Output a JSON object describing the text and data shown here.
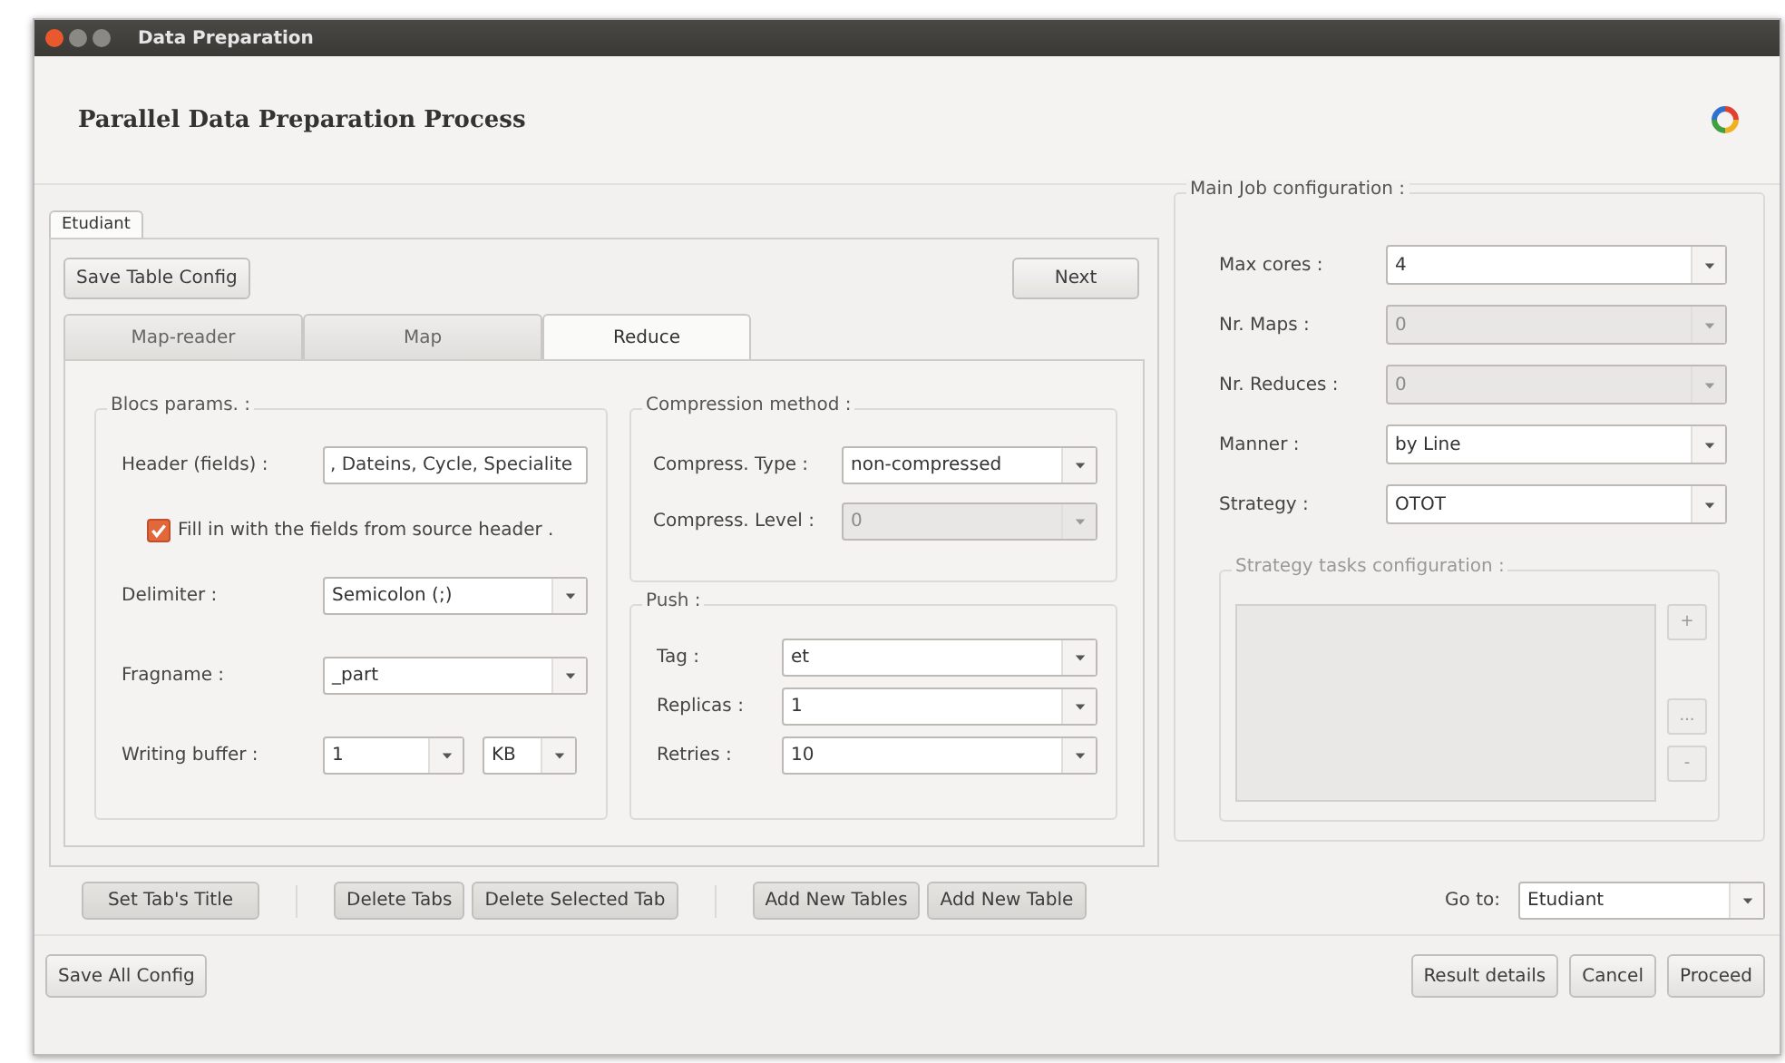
{
  "window": {
    "title": "Data Preparation"
  },
  "header": {
    "title": "Parallel Data Preparation Process"
  },
  "table_tabs": [
    {
      "label": "Etudiant",
      "selected": true
    }
  ],
  "save_table_config": "Save Table Config",
  "next": "Next",
  "step_tabs": [
    {
      "label": "Map-reader",
      "selected": false
    },
    {
      "label": "Map",
      "selected": false
    },
    {
      "label": "Reduce",
      "selected": true
    }
  ],
  "blocs_params": {
    "title": "Blocs params. :",
    "fields": [
      {
        "kind": "text",
        "label": "Header (fields) :",
        "value": ", Dateins, Cycle, Specialite"
      },
      {
        "kind": "checkbox",
        "label": "Fill in with the fields from source header .",
        "checked": true
      },
      {
        "kind": "combo",
        "label": "Delimiter :",
        "value": "Semicolon  (;)",
        "disabled": false
      },
      {
        "kind": "combo",
        "label": "Fragname :",
        "value": "_part",
        "disabled": false
      },
      {
        "kind": "combo",
        "label": "Writing buffer :",
        "value": "1",
        "unit": "KB",
        "disabled": false
      }
    ]
  },
  "compression": {
    "title": "Compression method :",
    "fields": [
      {
        "kind": "combo",
        "label": "Compress. Type :",
        "value": "non-compressed",
        "disabled": false
      },
      {
        "kind": "combo",
        "label": "Compress. Level :",
        "value": "0",
        "disabled": true
      }
    ]
  },
  "push": {
    "title": "Push :",
    "fields": [
      {
        "kind": "combo",
        "label": "Tag :",
        "value": "et",
        "disabled": false
      },
      {
        "kind": "combo",
        "label": "Replicas :",
        "value": "1",
        "disabled": false
      },
      {
        "kind": "combo",
        "label": "Retries :",
        "value": "10",
        "disabled": false
      }
    ]
  },
  "main_job": {
    "title": "Main Job configuration :",
    "fields": [
      {
        "kind": "combo",
        "label": "Max cores :",
        "value": "4",
        "disabled": false
      },
      {
        "kind": "combo",
        "label": "Nr. Maps :",
        "value": "0",
        "disabled": true
      },
      {
        "kind": "combo",
        "label": "Nr. Reduces :",
        "value": "0",
        "disabled": true
      },
      {
        "kind": "combo",
        "label": "Manner :",
        "value": "by Line",
        "disabled": false
      },
      {
        "kind": "combo",
        "label": "Strategy :",
        "value": "OTOT",
        "disabled": false
      }
    ]
  },
  "strategy_tasks": {
    "title": "Strategy tasks configuration :",
    "disabled": true,
    "buttons": [
      "+",
      "...",
      "-"
    ]
  },
  "tab_actions": [
    [
      "Set Tab's Title"
    ],
    [
      "Delete Tabs",
      "Delete Selected Tab"
    ],
    [
      "Add New Tables",
      "Add New Table"
    ]
  ],
  "goto": {
    "label": "Go to:",
    "value": "Etudiant"
  },
  "footer_left": "Save All Config",
  "footer_right": [
    "Result details",
    "Cancel",
    "Proceed"
  ]
}
